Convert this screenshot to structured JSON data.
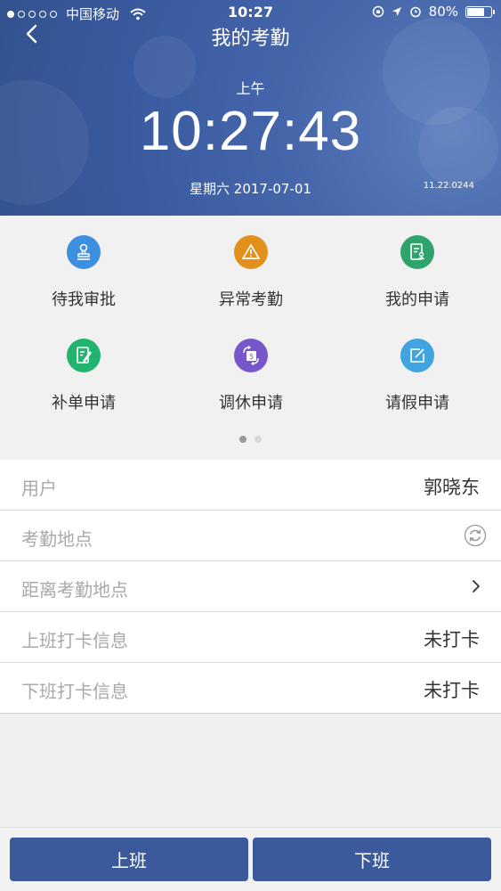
{
  "status_bar": {
    "carrier": "中国移动",
    "time": "10:27",
    "battery": "80%",
    "battery_level": 0.8
  },
  "nav": {
    "title": "我的考勤",
    "back_icon": "chevron-left-icon"
  },
  "clock": {
    "period": "上午",
    "time": "10:27:43",
    "date": "星期六 2017-07-01",
    "version": "11.22.0244"
  },
  "grid": {
    "items": [
      {
        "label": "待我审批",
        "icon": "stamp-icon",
        "color": "#3d8fe0"
      },
      {
        "label": "异常考勤",
        "icon": "warning-icon",
        "color": "#e2901c"
      },
      {
        "label": "我的申请",
        "icon": "document-person-icon",
        "color": "#2fa36c"
      },
      {
        "label": "补单申请",
        "icon": "document-pen-icon",
        "color": "#22b36f"
      },
      {
        "label": "调休申请",
        "icon": "calendar-swap-icon",
        "color": "#7656c8"
      },
      {
        "label": "请假申请",
        "icon": "edit-icon",
        "color": "#41a3e0"
      }
    ],
    "pages": 2,
    "active_page": 1
  },
  "rows": [
    {
      "label": "用户",
      "value": "郭晓东"
    },
    {
      "label": "考勤地点",
      "value": "",
      "icon": "refresh-icon"
    },
    {
      "label": "距离考勤地点",
      "value": "",
      "icon": "chevron-right-icon"
    },
    {
      "label": "上班打卡信息",
      "value": "未打卡"
    },
    {
      "label": "下班打卡信息",
      "value": "未打卡"
    }
  ],
  "buttons": {
    "clock_in": "上班",
    "clock_out": "下班",
    "color": "#3b5a9c"
  }
}
